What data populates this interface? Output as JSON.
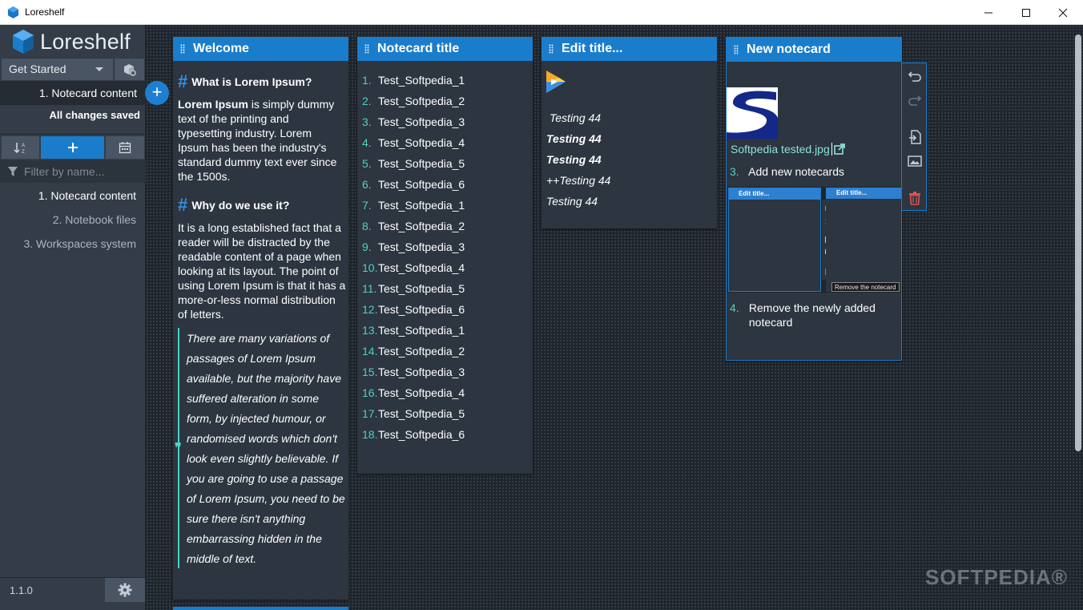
{
  "window": {
    "title": "Loreshelf",
    "controls": {
      "minimize": "—",
      "maximize": "☐",
      "close": "✕"
    }
  },
  "sidebar": {
    "logo": "Loreshelf",
    "notebook": "Get Started",
    "current_note": "1. Notecard content",
    "add_symbol": "+",
    "save_status": "All changes saved",
    "filter_placeholder": "Filter by name...",
    "items": [
      {
        "label": "1. Notecard content",
        "active": true
      },
      {
        "label": "2. Notebook files",
        "active": false
      },
      {
        "label": "3. Workspaces system",
        "active": false
      }
    ],
    "version": "1.1.0"
  },
  "cards": {
    "welcome": {
      "title": "Welcome",
      "heading1": "What is Lorem Ipsum?",
      "para1_bold": "Lorem Ipsum",
      "para1_rest": " is simply dummy text of the printing and typesetting industry. Lorem Ipsum has been the industry's standard dummy text ever since the 1500s.",
      "heading2": "Why do we use it?",
      "para2": "It is a long established fact that a reader will be distracted by the readable content of a page when looking at its layout. The point of using Lorem Ipsum is that it has a more-or-less normal distribution of letters.",
      "quote": "There are many variations of passages of Lorem Ipsum available, but the majority have suffered alteration in some form, by injected humour, or randomised words which don't look even slightly believable. If you are going to use a passage of Lorem Ipsum, you need to be sure there isn't anything embarrassing hidden in the middle of text."
    },
    "list": {
      "title": "Notecard title",
      "items": [
        {
          "num": "1.",
          "text": "Test_Softpedia_1"
        },
        {
          "num": "2.",
          "text": "Test_Softpedia_2"
        },
        {
          "num": "3.",
          "text": "Test_Softpedia_3"
        },
        {
          "num": "4.",
          "text": "Test_Softpedia_4"
        },
        {
          "num": "5.",
          "text": "Test_Softpedia_5"
        },
        {
          "num": "6.",
          "text": "Test_Softpedia_6"
        },
        {
          "num": "7.",
          "text": "Test_Softpedia_1"
        },
        {
          "num": "8.",
          "text": "Test_Softpedia_2"
        },
        {
          "num": "9.",
          "text": "Test_Softpedia_3"
        },
        {
          "num": "10.",
          "text": "Test_Softpedia_4"
        },
        {
          "num": "11.",
          "text": "Test_Softpedia_5"
        },
        {
          "num": "12.",
          "text": "Test_Softpedia_6"
        },
        {
          "num": "13.",
          "text": "Test_Softpedia_1"
        },
        {
          "num": "14.",
          "text": "Test_Softpedia_2"
        },
        {
          "num": "15.",
          "text": "Test_Softpedia_3"
        },
        {
          "num": "16.",
          "text": "Test_Softpedia_4"
        },
        {
          "num": "17.",
          "text": "Test_Softpedia_5"
        },
        {
          "num": "18.",
          "text": "Test_Softpedia_6"
        }
      ]
    },
    "edit": {
      "title": "Edit title...",
      "lines": [
        "Testing 44",
        "Testing 44",
        "Testing 44",
        "++Testing 44",
        "Testing 44"
      ]
    },
    "newcard": {
      "title": "New notecard",
      "file_link": "Softpedia tested.jpg",
      "step3_num": "3.",
      "step3_text": "Add new notecards",
      "mini_title1": "Edit title...",
      "mini_title2": "Edit title...",
      "mini_tooltip": "Remove the notecard",
      "step4_num": "4.",
      "step4_text": "Remove the newly added notecard"
    }
  },
  "watermark": "SOFTPEDIA®",
  "colors": {
    "accent": "#1a7dcc",
    "sidebar": "#333c47",
    "card": "#2c3540",
    "list_number": "#4fd1c5",
    "link": "#8fe0d8",
    "delete": "#e0554f"
  }
}
